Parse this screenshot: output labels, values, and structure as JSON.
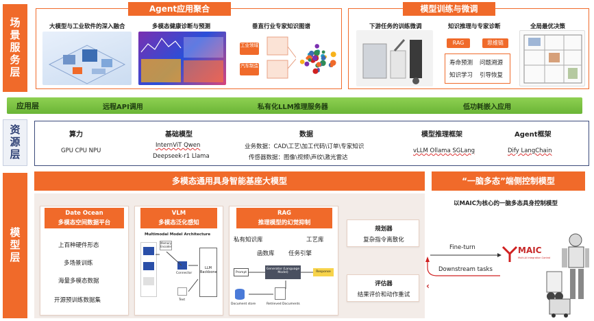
{
  "rows": {
    "scene": "场景服务层",
    "resource": "资源层",
    "model": "模型层"
  },
  "scene": {
    "agent_title": "Agent应用聚合",
    "agent_items": [
      "大模型与工业软件的深入融合",
      "多模态健康诊断与预测",
      "垂直行业专家知识图谱"
    ],
    "kg_tags": [
      "工业领域",
      "汽车制造"
    ],
    "train_title": "模型训练与微调",
    "train_items": [
      "下游任务的训练微调",
      "知识推理与专家诊断",
      "全局最优决策"
    ],
    "rag_pill": "RAG",
    "think_pill": "思维链",
    "grid_items": [
      "寿命预测",
      "问题溯源",
      "知识学习",
      "引导恢复"
    ]
  },
  "app_bar": {
    "label": "应用层",
    "items": [
      "远程API调用",
      "私有化LLM推理服务器",
      "低功耗嵌入应用"
    ]
  },
  "resource": {
    "cols": [
      {
        "title": "算力",
        "lines": [
          "GPU CPU NPU"
        ]
      },
      {
        "title": "基础模型",
        "lines": [
          "InternViT  Qwen",
          "Deepseek-r1 Llama"
        ]
      },
      {
        "title": "数据",
        "lines": [
          "业务数据：CAD\\工艺\\加工代码\\订单\\专家知识",
          "传感器数据：图像\\视频\\声纹\\激光雷达"
        ]
      },
      {
        "title": "模型推理框架",
        "lines": [
          "vLLM Ollama SGLang"
        ]
      },
      {
        "title": "Agent框架",
        "lines": [
          "Dify  LangChain"
        ]
      }
    ]
  },
  "model": {
    "banner": "多模态通用具身智能基座大模型",
    "right_banner": "“一脑多态”端侧控制模型",
    "right_sub": "以MAIC为核心的一脑多态具身控制模型",
    "date_ocean_title": [
      "Date Ocean",
      "多模态空间数据平台"
    ],
    "date_ocean_items": [
      "上百种硬件形态",
      "多场景训练",
      "海量多模态数据",
      "开源预训练数据集"
    ],
    "vlm_title": [
      "VLM",
      "多模态泛化感知"
    ],
    "vlm_arch": "Multimodal Model Architecture",
    "vlm_parts": [
      "Memory Encoder",
      "Connector",
      "Text",
      "LLM Backbone"
    ],
    "rag_title": [
      "RAG",
      "推理模型的幻觉抑制"
    ],
    "rag_items": [
      "私有知识库",
      "工艺库",
      "函数库",
      "任务引擎"
    ],
    "rag_flow": [
      "Prompt",
      "Generator (Language Model)",
      "Response",
      "Document store",
      "Retrieved Documents"
    ],
    "planner_title": "规划器",
    "planner_desc": "复杂指令离散化",
    "evaluator_title": "评估器",
    "evaluator_desc": "结果评价和动作重试",
    "finetune": "Fine-turn",
    "downstream": "Downstream tasks",
    "maic": "MAIC",
    "maic_sub": "Multi-AI Integration Control"
  },
  "colors": {
    "accent": "#f06a2a",
    "green": "#7cc142",
    "navy": "#2d3f73"
  }
}
